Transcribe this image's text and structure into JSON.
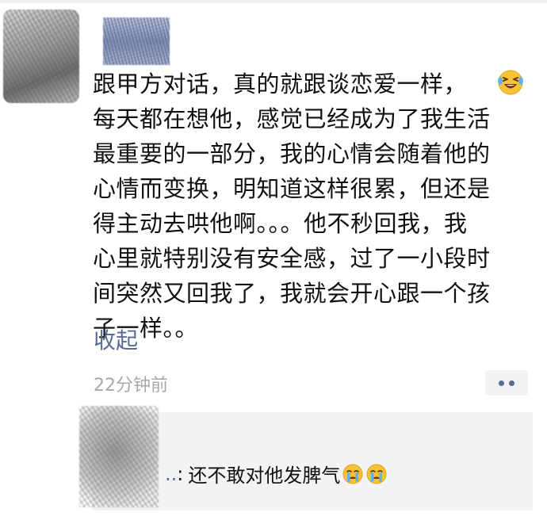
{
  "post": {
    "lines": [
      "跟甲方对话，真的就跟谈恋爱一样，",
      "每天都在想他，感觉已经成为了我生活",
      "最重要的一部分，我的心情会随着他的",
      "心情而变换，明知道这样很累，但还是",
      "得主动去哄他啊。。。他不秒回我，我",
      "心里就特别没有安全感，过了一小段时",
      "间突然又回我了，我就会开心跟一个孩",
      "子一样。。"
    ],
    "emoji": "laughing-crying-emoji",
    "collapse_label": "收起",
    "timestamp": "22分钟前"
  },
  "comment": {
    "user": "..",
    "separator": ":",
    "text": "还不敢对他发脾气",
    "emojis": [
      "crying-emoji",
      "crying-emoji"
    ]
  },
  "colors": {
    "link": "#576b95",
    "timestamp": "#a8a8a8",
    "comment_bg": "#f3f3f5"
  }
}
